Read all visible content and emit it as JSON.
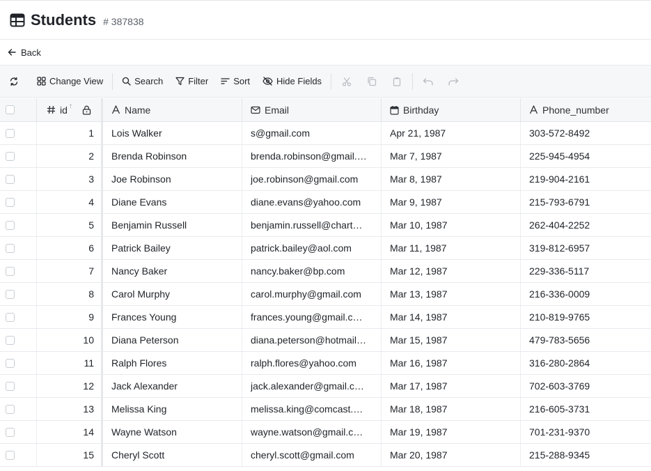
{
  "header": {
    "title": "Students",
    "record_id": "# 387838"
  },
  "nav": {
    "back_label": "Back"
  },
  "toolbar": {
    "change_view": "Change View",
    "search": "Search",
    "filter": "Filter",
    "sort": "Sort",
    "hide_fields": "Hide Fields"
  },
  "table": {
    "columns": {
      "id": "id",
      "name": "Name",
      "email": "Email",
      "birthday": "Birthday",
      "phone": "Phone_number"
    },
    "rows": [
      {
        "id": "1",
        "name": "Lois Walker",
        "email": "s@gmail.com",
        "birthday": "Apr 21, 1987",
        "phone": "303-572-8492"
      },
      {
        "id": "2",
        "name": "Brenda Robinson",
        "email": "brenda.robinson@gmail.…",
        "birthday": "Mar 7, 1987",
        "phone": "225-945-4954"
      },
      {
        "id": "3",
        "name": "Joe Robinson",
        "email": "joe.robinson@gmail.com",
        "birthday": "Mar 8, 1987",
        "phone": "219-904-2161"
      },
      {
        "id": "4",
        "name": "Diane Evans",
        "email": "diane.evans@yahoo.com",
        "birthday": "Mar 9, 1987",
        "phone": "215-793-6791"
      },
      {
        "id": "5",
        "name": "Benjamin Russell",
        "email": "benjamin.russell@chart…",
        "birthday": "Mar 10, 1987",
        "phone": "262-404-2252"
      },
      {
        "id": "6",
        "name": "Patrick Bailey",
        "email": "patrick.bailey@aol.com",
        "birthday": "Mar 11, 1987",
        "phone": "319-812-6957"
      },
      {
        "id": "7",
        "name": "Nancy Baker",
        "email": "nancy.baker@bp.com",
        "birthday": "Mar 12, 1987",
        "phone": "229-336-5117"
      },
      {
        "id": "8",
        "name": "Carol Murphy",
        "email": "carol.murphy@gmail.com",
        "birthday": "Mar 13, 1987",
        "phone": "216-336-0009"
      },
      {
        "id": "9",
        "name": "Frances Young",
        "email": "frances.young@gmail.c…",
        "birthday": "Mar 14, 1987",
        "phone": "210-819-9765"
      },
      {
        "id": "10",
        "name": "Diana Peterson",
        "email": "diana.peterson@hotmail…",
        "birthday": "Mar 15, 1987",
        "phone": "479-783-5656"
      },
      {
        "id": "11",
        "name": "Ralph Flores",
        "email": "ralph.flores@yahoo.com",
        "birthday": "Mar 16, 1987",
        "phone": "316-280-2864"
      },
      {
        "id": "12",
        "name": "Jack Alexander",
        "email": "jack.alexander@gmail.c…",
        "birthday": "Mar 17, 1987",
        "phone": "702-603-3769"
      },
      {
        "id": "13",
        "name": "Melissa King",
        "email": "melissa.king@comcast.…",
        "birthday": "Mar 18, 1987",
        "phone": "216-605-3731"
      },
      {
        "id": "14",
        "name": "Wayne Watson",
        "email": "wayne.watson@gmail.c…",
        "birthday": "Mar 19, 1987",
        "phone": "701-231-9370"
      },
      {
        "id": "15",
        "name": "Cheryl Scott",
        "email": "cheryl.scott@gmail.com",
        "birthday": "Mar 20, 1987",
        "phone": "215-288-9345"
      }
    ]
  },
  "icons": {
    "table": "table-icon",
    "back": "arrow-left-icon",
    "refresh": "refresh-icon",
    "change_view": "grid-icon",
    "search": "search-icon",
    "filter": "filter-icon",
    "sort": "sort-icon",
    "hide_fields": "eye-off-icon",
    "cut": "scissors-icon",
    "copy": "copy-icon",
    "paste": "clipboard-icon",
    "undo": "undo-icon",
    "redo": "redo-icon"
  }
}
